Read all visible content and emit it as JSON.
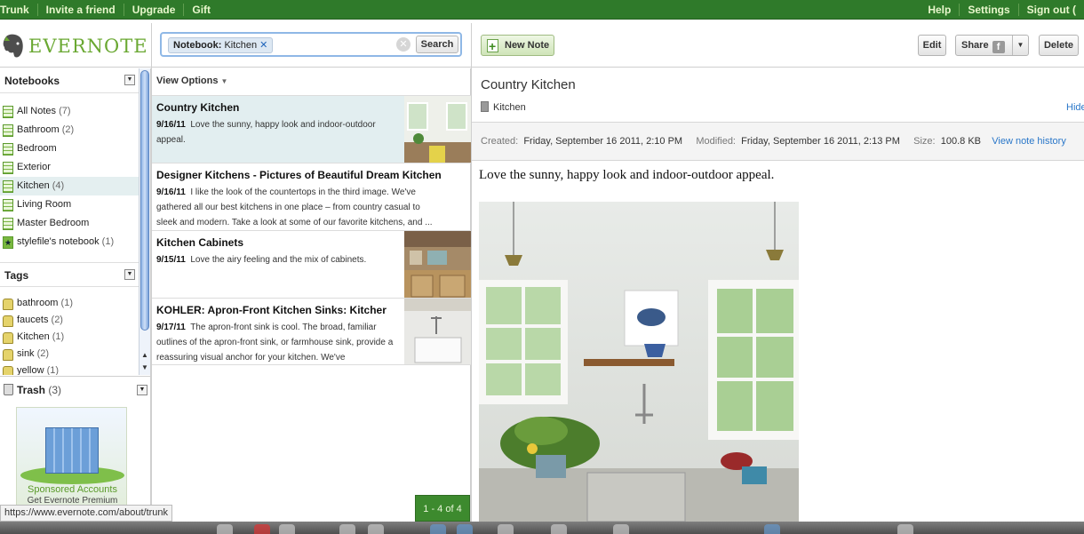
{
  "topbar": {
    "left_links": [
      "Trunk",
      "Invite a friend",
      "Upgrade",
      "Gift"
    ],
    "right_links": [
      "Help",
      "Settings",
      "Sign out ("
    ]
  },
  "header": {
    "logo_text": "EVERNOTE",
    "search_chip_label": "Notebook:",
    "search_chip_value": "Kitchen",
    "search_button": "Search",
    "new_note": "New Note",
    "edit": "Edit",
    "share": "Share",
    "delete": "Delete"
  },
  "sidebar": {
    "notebooks_title": "Notebooks",
    "notebooks": [
      {
        "label": "All Notes",
        "count": "(7)"
      },
      {
        "label": "Bathroom",
        "count": "(2)"
      },
      {
        "label": "Bedroom",
        "count": ""
      },
      {
        "label": "Exterior",
        "count": ""
      },
      {
        "label": "Kitchen",
        "count": "(4)"
      },
      {
        "label": "Living Room",
        "count": ""
      },
      {
        "label": "Master Bedroom",
        "count": ""
      },
      {
        "label": "stylefile's notebook",
        "count": "(1)"
      }
    ],
    "tags_title": "Tags",
    "tags": [
      {
        "label": "bathroom",
        "count": "(1)"
      },
      {
        "label": "faucets",
        "count": "(2)"
      },
      {
        "label": "Kitchen",
        "count": "(1)"
      },
      {
        "label": "sink",
        "count": "(2)"
      },
      {
        "label": "yellow",
        "count": "(1)"
      }
    ],
    "trash_label": "Trash",
    "trash_count": "(3)",
    "ad_line1": "Sponsored Accounts",
    "ad_line2": "Get Evernote Premium"
  },
  "notelist": {
    "view_options": "View Options",
    "notes": [
      {
        "title": "Country Kitchen",
        "date": "9/16/11",
        "snippet": "Love the sunny, happy look and indoor-outdoor appeal."
      },
      {
        "title": "Designer Kitchens - Pictures of Beautiful Dream Kitchen",
        "date": "9/16/11",
        "snippet": "I like the look of the countertops in the third image. We've gathered all our best kitchens in one place – from country casual to sleek and modern. Take a look at some of our favorite kitchens, and ..."
      },
      {
        "title": "Kitchen Cabinets",
        "date": "9/15/11",
        "snippet": "Love the airy feeling and the mix of cabinets."
      },
      {
        "title": "KOHLER: Apron-Front Kitchen Sinks: Kitcher",
        "date": "9/17/11",
        "snippet": "The apron-front sink is cool. The broad, familiar outlines of the apron-front sink, or farmhouse sink, provide a reassuring visual anchor for your kitchen. We've"
      }
    ],
    "pager": "1 - 4 of 4"
  },
  "noteview": {
    "title": "Country Kitchen",
    "notebook": "Kitchen",
    "hide": "Hide",
    "created_label": "Created:",
    "created": "Friday, September 16 2011, 2:10 PM",
    "modified_label": "Modified:",
    "modified": "Friday, September 16 2011, 2:13 PM",
    "size_label": "Size:",
    "size": "100.8 KB",
    "history_link": "View note history",
    "body": "Love the sunny, happy look and indoor-outdoor appeal."
  },
  "status_url": "https://www.evernote.com/about/trunk",
  "colors": {
    "brand_green": "#2f7a2a",
    "logo_green": "#6aa832",
    "link_blue": "#2a77c9"
  }
}
